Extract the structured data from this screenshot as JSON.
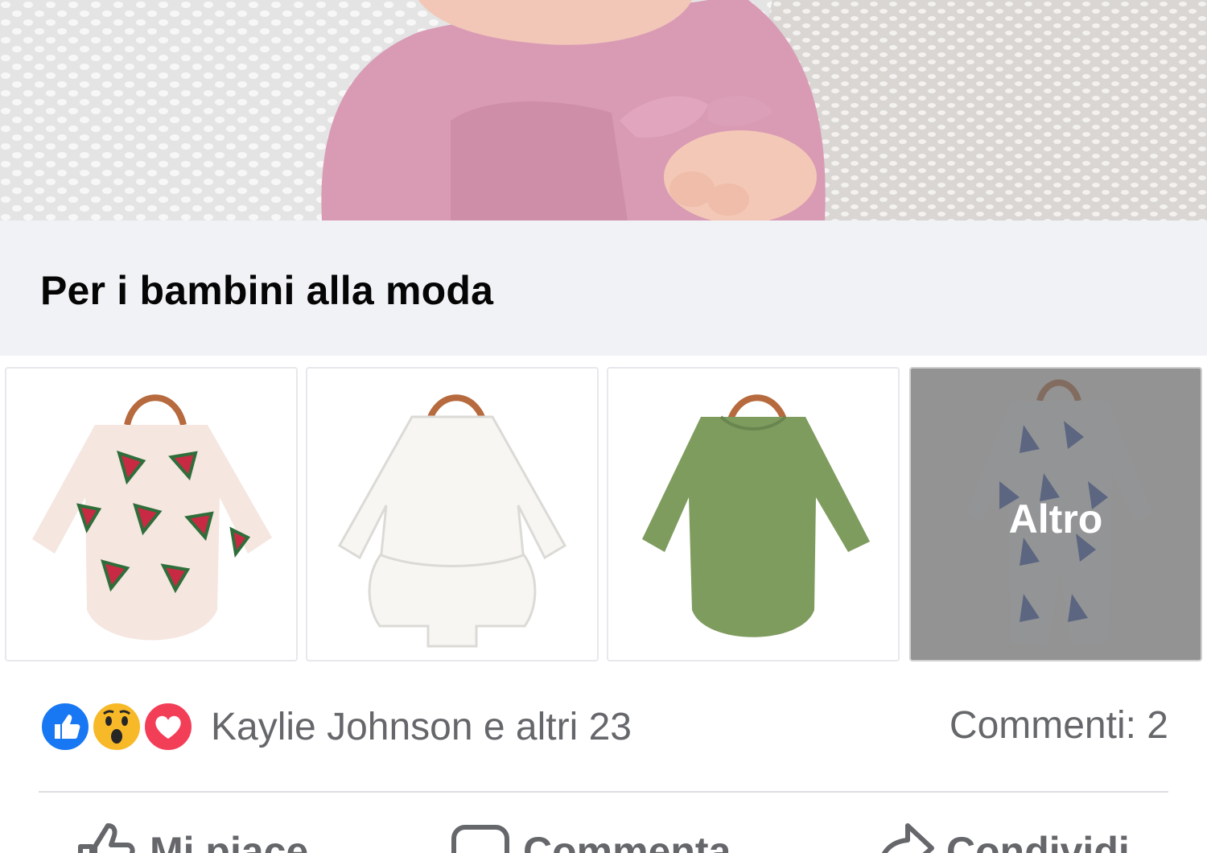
{
  "caption": {
    "title": "Per i bambini alla moda"
  },
  "products": {
    "items": [
      {
        "description": "watermelon print long-sleeve bodysuit"
      },
      {
        "description": "white long-sleeve bodysuit dress"
      },
      {
        "description": "sage green long-sleeve bodysuit"
      },
      {
        "description": "blue leaf print footed sleeper"
      }
    ],
    "more_label": "Altro"
  },
  "reactions": {
    "icons": [
      "like-icon",
      "wow-icon",
      "love-icon"
    ],
    "names_text": "Kaylie Johnson e altri 23",
    "comments_text": "Commenti: 2"
  },
  "actions": {
    "like_label": "Mi piace",
    "comment_label": "Commenta",
    "share_label": "Condividi"
  },
  "colors": {
    "like_blue": "#1877f2",
    "love_red": "#f33e58",
    "wow_yellow": "#f7b928",
    "secondary_text": "#65676b",
    "caption_bg": "#f0f2f5"
  }
}
